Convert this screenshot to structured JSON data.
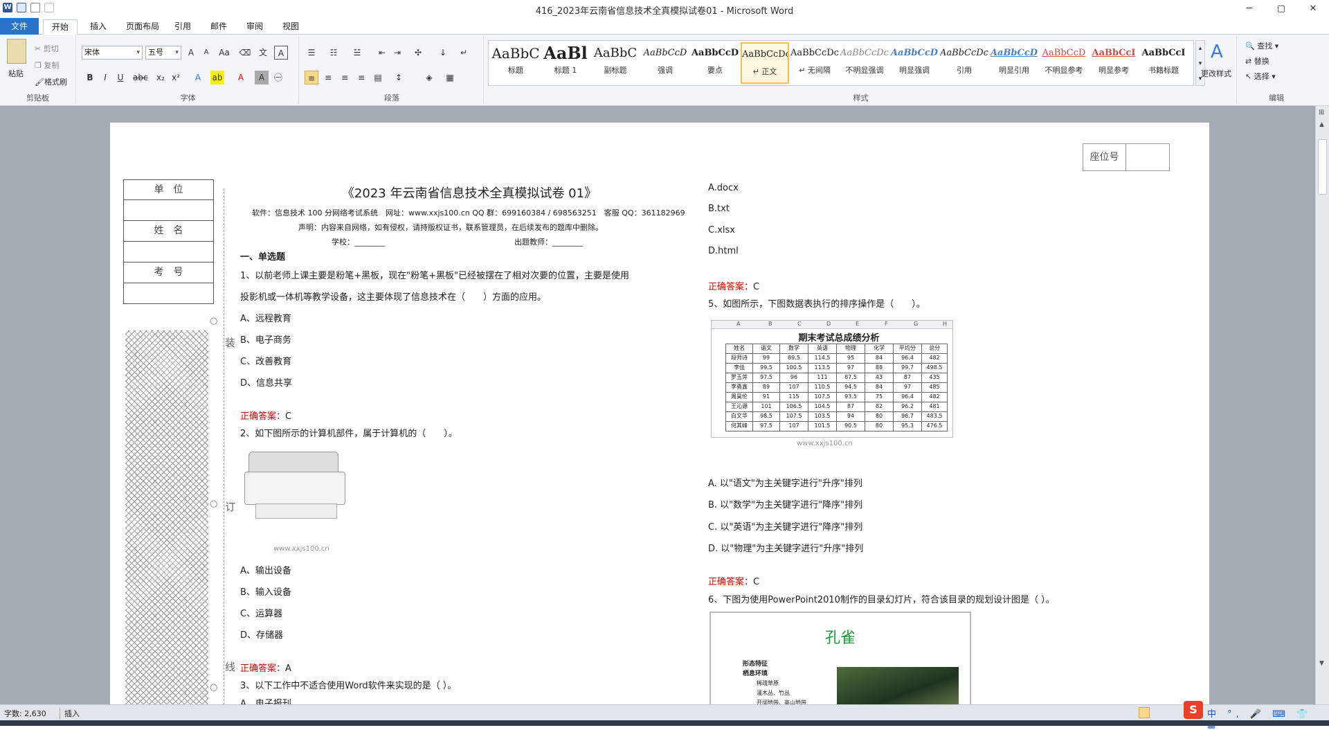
{
  "window": {
    "title": "416_2023年云南省信息技术全真模拟试卷01  -  Microsoft Word",
    "controls": [
      "─",
      "▢",
      "✕"
    ]
  },
  "tabs": [
    "文件",
    "开始",
    "插入",
    "页面布局",
    "引用",
    "邮件",
    "审阅",
    "视图"
  ],
  "clipboard": {
    "paste": "粘贴",
    "cut": "剪切",
    "copy": "复制",
    "format": "格式刷",
    "label": "剪贴板"
  },
  "font": {
    "name": "宋体",
    "size": "五号",
    "label": "字体"
  },
  "paragraph": {
    "label": "段落"
  },
  "styles": {
    "label": "样式",
    "change": "更改样式",
    "items": [
      {
        "prev": "AaBbC",
        "name": "标题"
      },
      {
        "prev": "AaBl",
        "name": "标题 1"
      },
      {
        "prev": "AaBbC",
        "name": "副标题"
      },
      {
        "prev": "AaBbCcD",
        "name": "强调"
      },
      {
        "prev": "AaBbCcD",
        "name": "要点"
      },
      {
        "prev": "AaBbCcDc",
        "name": "↵ 正文"
      },
      {
        "prev": "AaBbCcDc",
        "name": "↵ 无间隔"
      },
      {
        "prev": "AaBbCcDc",
        "name": "不明显强调"
      },
      {
        "prev": "AaBbCcD",
        "name": "明显强调"
      },
      {
        "prev": "AaBbCcDc",
        "name": "引用"
      },
      {
        "prev": "AaBbCcD",
        "name": "明显引用"
      },
      {
        "prev": "AaBbCcD",
        "name": "不明显参考"
      },
      {
        "prev": "AaBbCcI",
        "name": "明显参考"
      },
      {
        "prev": "AaBbCcI",
        "name": "书籍标题"
      }
    ]
  },
  "editing": {
    "find": "查找",
    "replace": "替换",
    "select": "选择",
    "label": "编辑"
  },
  "doc": {
    "seat": "座位号",
    "side": [
      "单　位",
      "姓　名",
      "考　号"
    ],
    "margin": [
      "装",
      "订",
      "线"
    ],
    "title": "《2023 年云南省信息技术全真模拟试卷 01》",
    "software": "软件：信息技术 100 分网络考试系统　网址：www.xxjs100.cn QQ 群：699160384 / 698563251　客服 QQ：361182969",
    "notice": "声明：内容来自网络，如有侵权，请持版权证书，联系管理员，在后续发布的题库中删除。",
    "school": "学校：________",
    "teacher": "出题教师：________",
    "section": "一、单选题",
    "q1a": "1、以前老师上课主要是粉笔+黑板，现在\"粉笔+黑板\"已经被摆在了相对次要的位置，主要是使用",
    "q1b": "投影机或一体机等教学设备，这主要体现了信息技术在（　　）方面的应用。",
    "q1opts": [
      "A、远程教育",
      "B、电子商务",
      "C、改善教育",
      "D、信息共享"
    ],
    "answerLabel": "正确答案：",
    "a1": "C",
    "q2": "2、如下图所示的计算机部件，属于计算机的（　　）。",
    "watermark": "www.xxjs100.cn",
    "q2opts": [
      "A、输出设备",
      "B、输入设备",
      "C、运算器",
      "D、存储器"
    ],
    "a2": "A",
    "q3": "3、以下工作中不适合使用Word软件来实现的是（ ）。",
    "q3partial": "A、电子报刊",
    "q3opts": [
      "A.docx",
      "B.txt",
      "C.xlsx",
      "D.html"
    ],
    "a3": "C",
    "q5": "5、如图所示，下图数据表执行的排序操作是（　　）。",
    "q5opts": [
      "A.  以\"语文\"为主关键字进行\"升序\"排列",
      "B.  以\"数学\"为主关键字进行\"降序\"排列",
      "C.  以\"英语\"为主关键字进行\"降序\"排列",
      "D.  以\"物理\"为主关键字进行\"升序\"排列"
    ],
    "a5": "C",
    "q6": "6、下图为使用PowerPoint2010制作的目录幻灯片，符合该目录的规划设计图是（ ）。",
    "slide": {
      "title": "孔雀",
      "l1": "形态特征",
      "l2": "栖息环境",
      "l3": "稀疏草原",
      "l4": "灌木丛、竹丛",
      "l5": "开阔地带、高山地带"
    }
  },
  "sheet": {
    "title": "期末考试总成绩分析",
    "cols": [
      "A",
      "B",
      "C",
      "D",
      "E",
      "F",
      "G",
      "H"
    ],
    "header": [
      "姓名",
      "语文",
      "数学",
      "英语",
      "物理",
      "化学",
      "平均分",
      "总分"
    ],
    "rows": [
      [
        "段师诗",
        "99",
        "89.5",
        "114.5",
        "95",
        "84",
        "96.4",
        "482"
      ],
      [
        "李佳",
        "99.5",
        "100.5",
        "113.5",
        "97",
        "88",
        "99.7",
        "498.5"
      ],
      [
        "罗玉萍",
        "97.5",
        "96",
        "111",
        "87.5",
        "43",
        "87",
        "435"
      ],
      [
        "李勇鑫",
        "89",
        "107",
        "110.5",
        "94.5",
        "84",
        "97",
        "485"
      ],
      [
        "周昊伦",
        "91",
        "115",
        "107.5",
        "93.5",
        "75",
        "96.4",
        "482"
      ],
      [
        "王沁源",
        "101",
        "106.5",
        "104.5",
        "87",
        "82",
        "96.2",
        "481"
      ],
      [
        "白文华",
        "98.5",
        "107.5",
        "103.5",
        "94",
        "80",
        "96.7",
        "483.5"
      ],
      [
        "何其峰",
        "97.5",
        "107",
        "101.5",
        "90.5",
        "80",
        "95.3",
        "476.5"
      ]
    ]
  },
  "status": {
    "words": "字数: 2,630",
    "mode": "插入"
  }
}
